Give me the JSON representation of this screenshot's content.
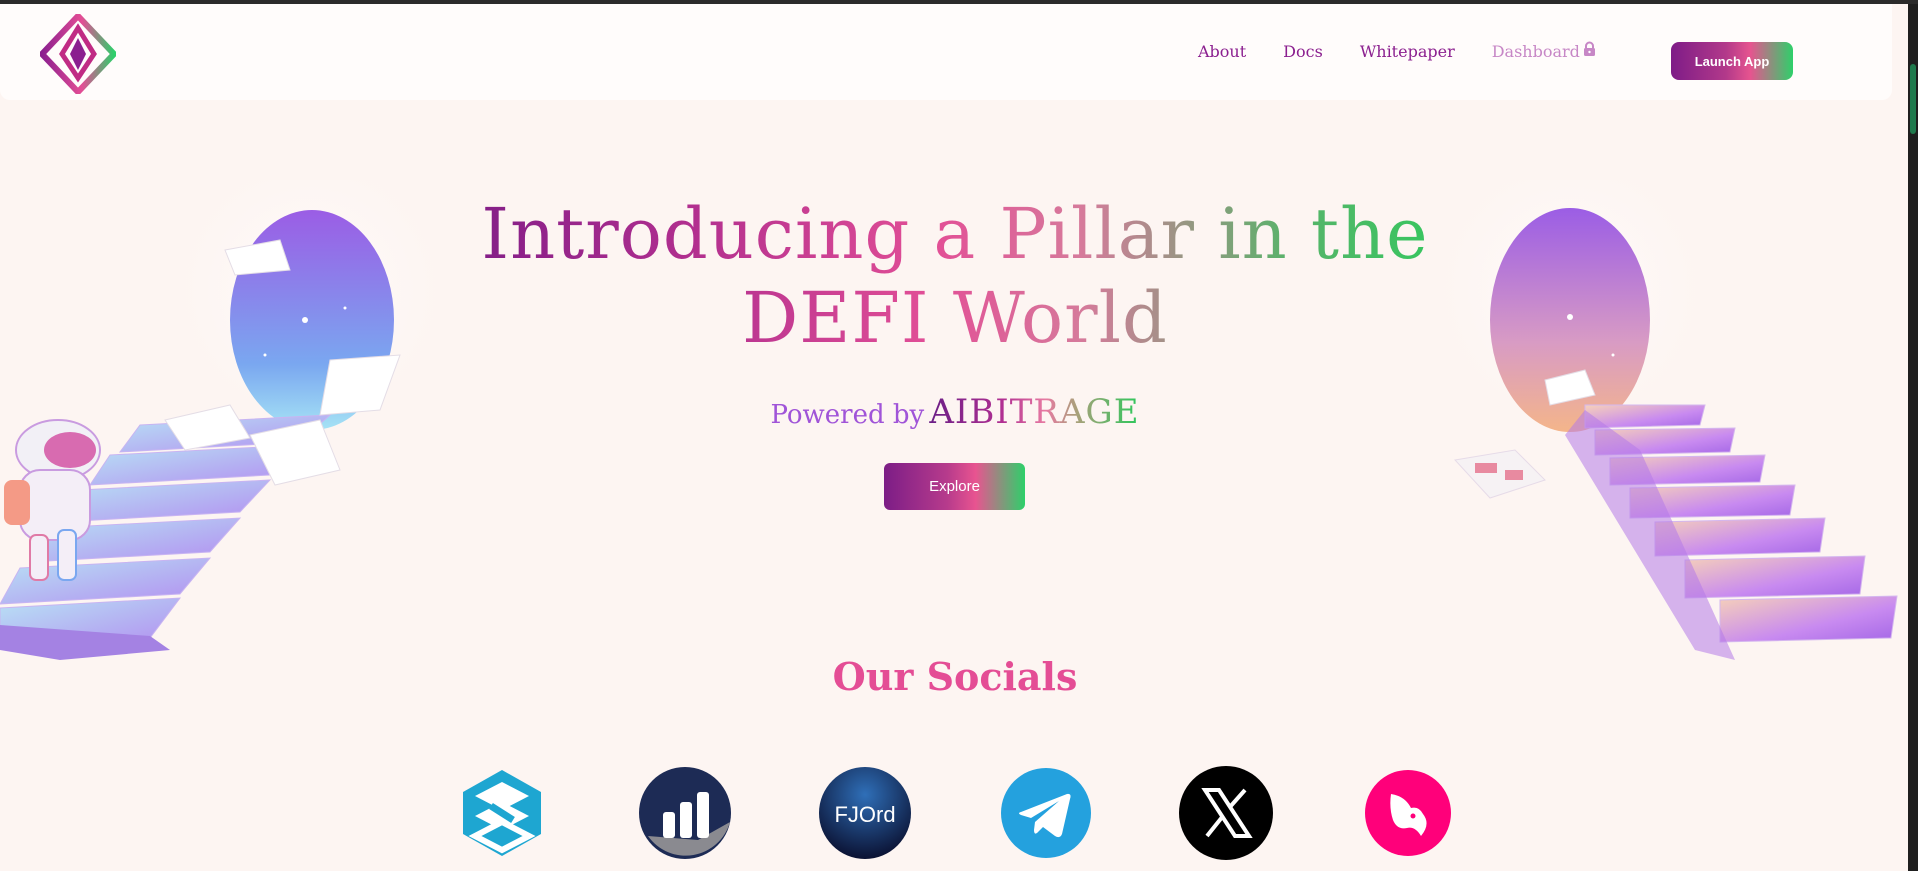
{
  "nav": {
    "items": [
      {
        "label": "About"
      },
      {
        "label": "Docs"
      },
      {
        "label": "Whitepaper"
      },
      {
        "label": "Dashboard"
      }
    ],
    "launch_label": "Launch App"
  },
  "hero": {
    "title_line1": "Introducing a Pillar in the",
    "title_line2": "DEFI World",
    "powered_prefix": "Powered by",
    "powered_brand": "AIBITRAGE",
    "explore_label": "Explore"
  },
  "socials": {
    "title": "Our Socials",
    "items": [
      {
        "name": "dextools-icon"
      },
      {
        "name": "dexscreener-icon"
      },
      {
        "name": "fjord-icon",
        "label": "FJOrd"
      },
      {
        "name": "telegram-icon"
      },
      {
        "name": "x-icon"
      },
      {
        "name": "uniswap-icon"
      }
    ]
  },
  "colors": {
    "brand_purple": "#8b1f8f",
    "brand_pink": "#e44d95",
    "brand_green": "#2ed06a",
    "background": "#fdf5f2"
  }
}
